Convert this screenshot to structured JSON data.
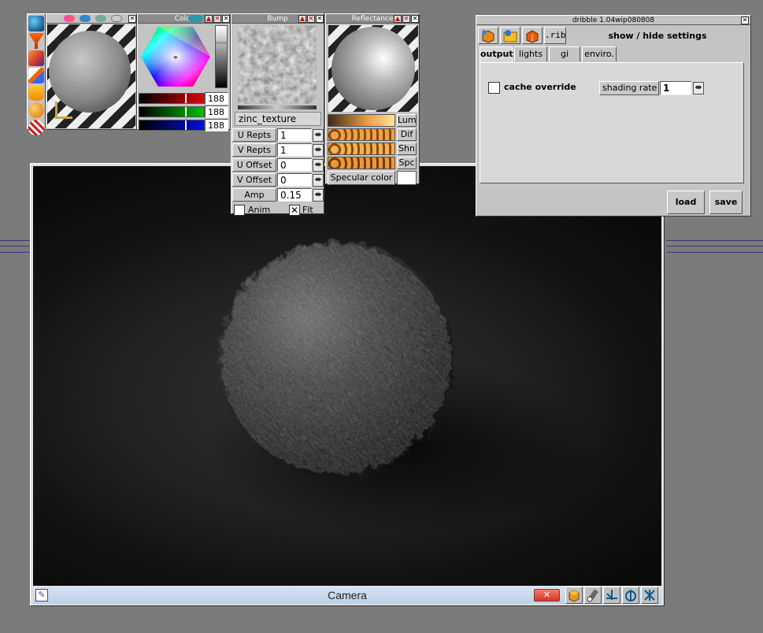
{
  "colors": {
    "desktop": "#7b7b7b",
    "panel": "#c4c4c4",
    "accent_red": "#e00000",
    "accent_green": "#00c000",
    "accent_blue": "#0010e0",
    "camera_bar": "#c9d8ea"
  },
  "color_panel": {
    "title": "Color",
    "channels": [
      {
        "name": "red",
        "value": "188",
        "color": "#e00000"
      },
      {
        "name": "green",
        "value": "188",
        "color": "#00c000"
      },
      {
        "name": "blue",
        "value": "188",
        "color": "#0010e0"
      }
    ]
  },
  "bump_panel": {
    "title": "Bump",
    "texture_name": "zinc_texture",
    "params": [
      {
        "label": "U Repts",
        "value": "1"
      },
      {
        "label": "V Repts",
        "value": "1"
      },
      {
        "label": "U Offset",
        "value": "0"
      },
      {
        "label": "V Offset",
        "value": "0"
      },
      {
        "label": "Amp",
        "value": "0.15"
      }
    ],
    "anim_label": "Anim",
    "flt_label": "Flt",
    "stepper_glyph": "⇼"
  },
  "reflectance_panel": {
    "title": "Reflectance",
    "rows": [
      "Lum",
      "Dif",
      "Shn",
      "Spc"
    ],
    "specular_label": "Specular color"
  },
  "dribble": {
    "title": "dribble 1.04wip080808",
    "rib_label": ".rib",
    "show_hide": "show / hide settings",
    "tabs": [
      "output",
      "lights",
      "gi",
      "enviro."
    ],
    "active_tab": "output",
    "cache_label": "cache override",
    "shading_label": "shading rate",
    "shading_value": "1",
    "load_label": "load",
    "save_label": "save"
  },
  "camera": {
    "title": "Camera"
  },
  "icons": [
    "globe-icon",
    "funnel-icon",
    "paint-tool-icon",
    "pencil-icon",
    "cylinder-icon",
    "sphere-icon",
    "striped-ball-icon",
    "close-icon",
    "cube-icon",
    "light-icon",
    "move-axis-icon",
    "rotate-axis-icon",
    "scale-axis-icon"
  ]
}
